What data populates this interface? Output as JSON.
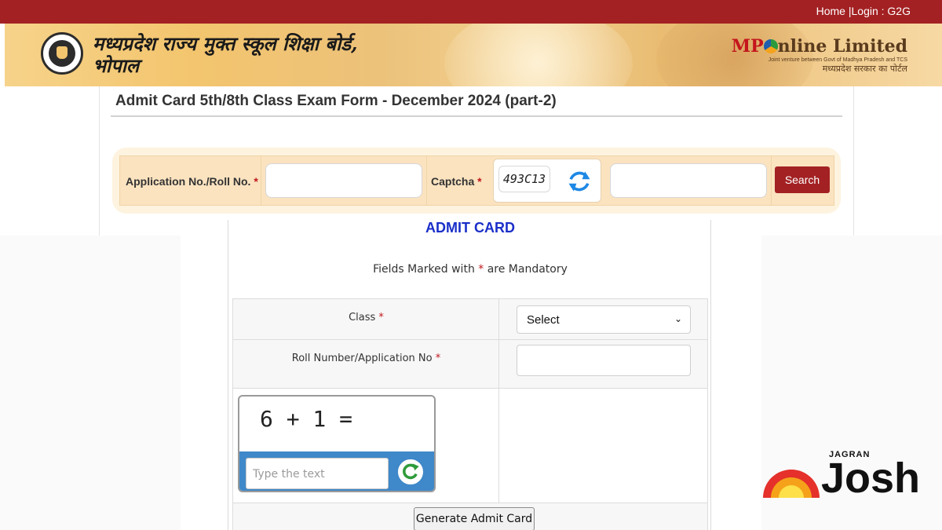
{
  "header": {
    "links": "Home |Login : G2G",
    "board_name": "मध्यप्रदेश राज्य मुक्त स्कूल शिक्षा बोर्ड, भोपाल",
    "mp_logo_prefix": "MP",
    "mp_logo_suffix": "nline Limited",
    "mp_logo_tagline": "Joint venture between Govt of Madhya Pradesh and TCS",
    "mp_logo_hindi": "मध्यप्रदेश सरकार का पोर्टल"
  },
  "search_panel": {
    "title": "Admit Card 5th/8th Class Exam Form - December 2024 (part-2)",
    "app_label": "Application No./Roll No.",
    "app_value": "",
    "captcha_label": "Captcha",
    "captcha_code": "493C13",
    "captcha_value": "",
    "search_button": "Search",
    "required_mark": "*"
  },
  "admit_form": {
    "title": "ADMIT CARD",
    "mandatory_prefix": "Fields Marked with",
    "mandatory_suffix": "are Mandatory",
    "required_mark": "*",
    "class_label": "Class",
    "class_selected": "Select",
    "roll_label": "Roll Number/Application No",
    "roll_value": "",
    "math_captcha": "6 + 1 =",
    "captcha_placeholder": "Type the text",
    "generate_button": "Generate Admit Card"
  },
  "watermark": {
    "small": "JAGRAN",
    "big": "Josh"
  },
  "colors": {
    "top_bar": "#a32123",
    "admit_title": "#1a2fc9",
    "search_button": "#a32123",
    "captcha_bar": "#3f88c9"
  }
}
